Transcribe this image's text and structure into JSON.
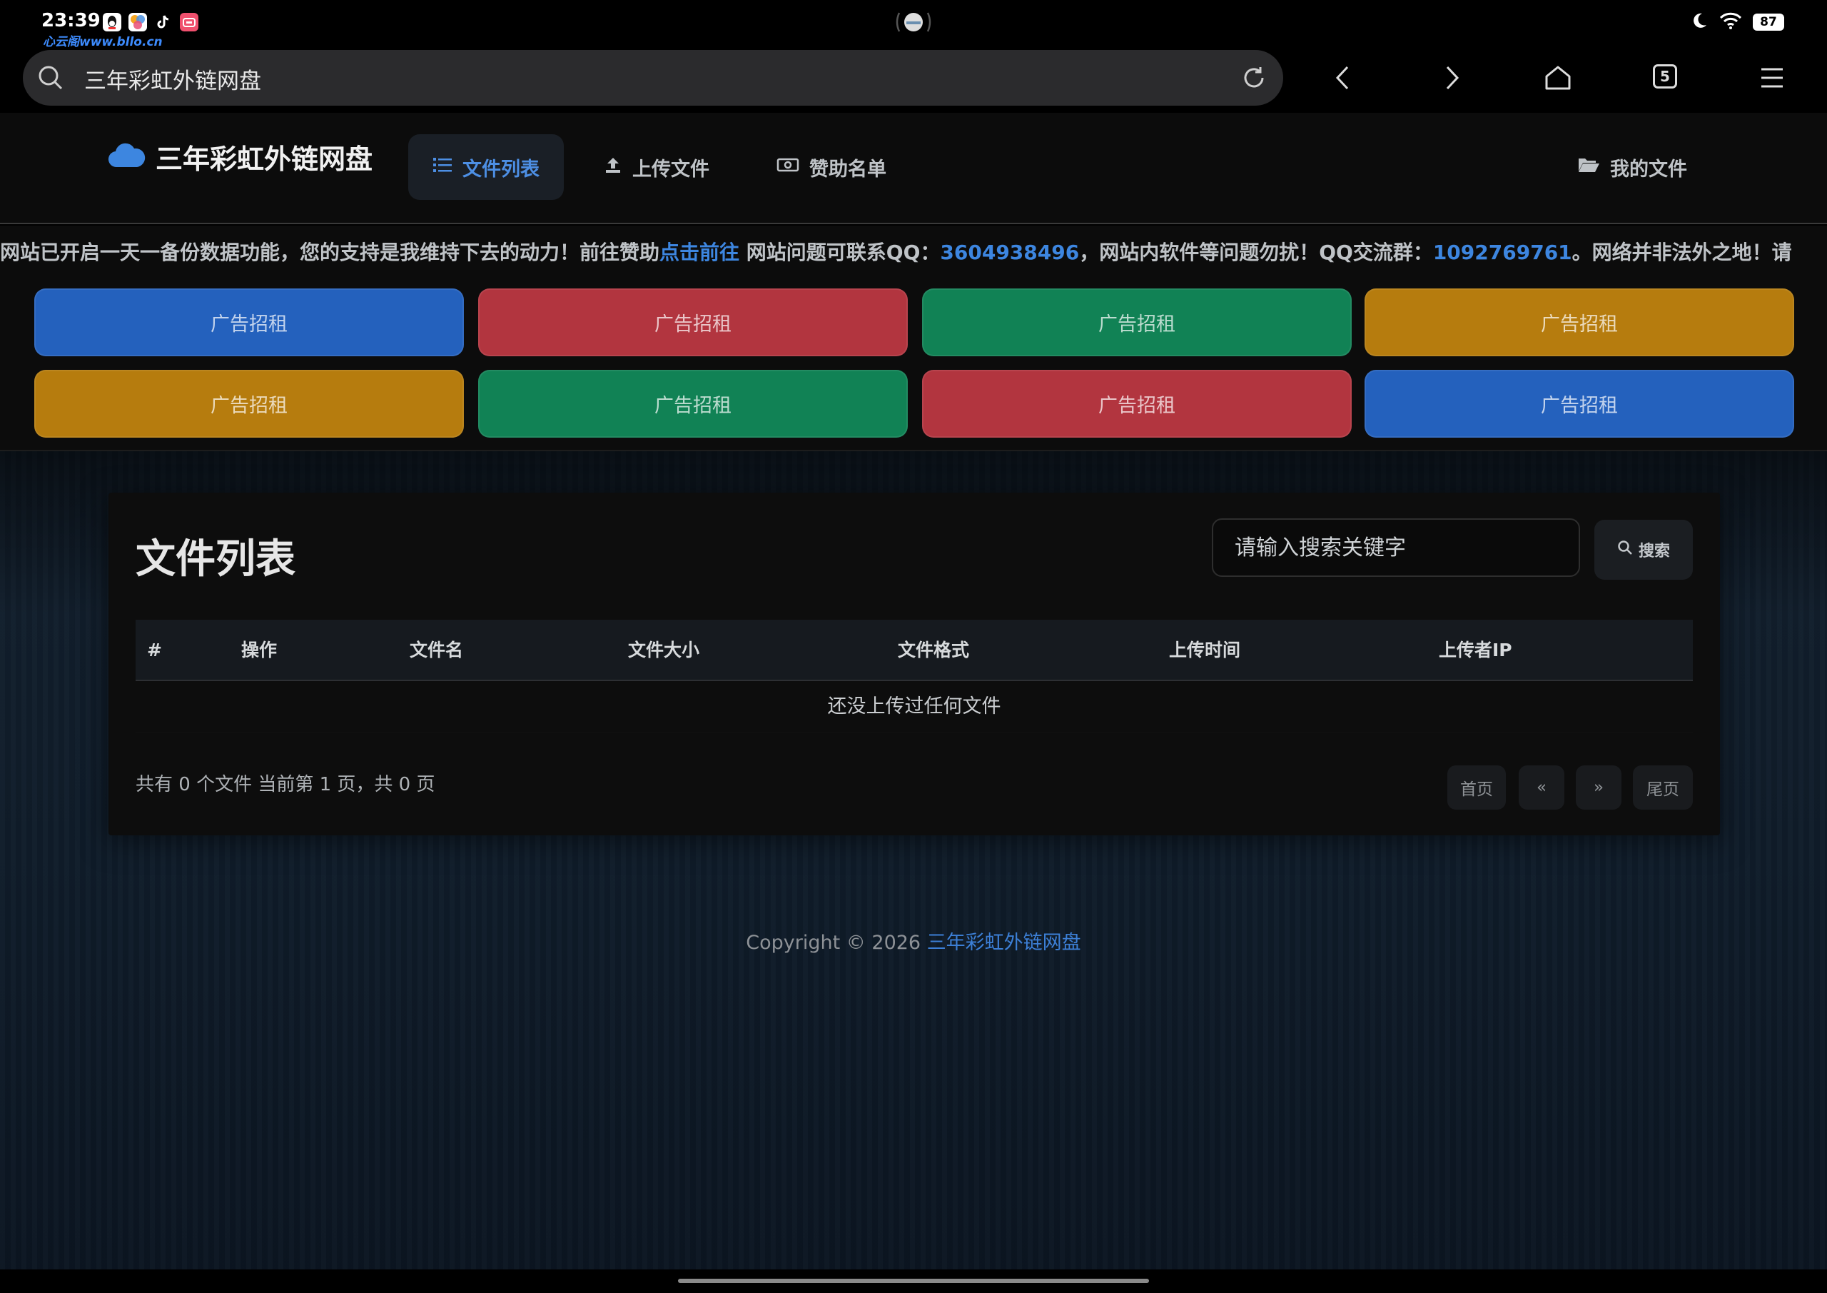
{
  "status_bar": {
    "time": "23:39",
    "watermark": "心云阁www.bllo.cn",
    "battery": "87"
  },
  "browser": {
    "address_text": "三年彩虹外链网盘",
    "tab_count": "5"
  },
  "site": {
    "brand": "三年彩虹外链网盘",
    "nav": {
      "file_list": "文件列表",
      "upload": "上传文件",
      "sponsors": "赞助名单",
      "my_files": "我的文件"
    }
  },
  "notice": {
    "part1": "网站已开启一天一备份数据功能，您的支持是我维持下去的动力！前往赞助",
    "link1": "点击前往",
    "part2": " 网站问题可联系QQ：",
    "qq": "3604938496",
    "part3": "，网站内软件等问题勿扰！QQ交流群：",
    "group": "1092769761",
    "part4": "。网络并非法外之地！请"
  },
  "ads": [
    {
      "label": "广告招租",
      "color": "#2461bd"
    },
    {
      "label": "广告招租",
      "color": "#b2353f"
    },
    {
      "label": "广告招租",
      "color": "#118255"
    },
    {
      "label": "广告招租",
      "color": "#b67c0e"
    },
    {
      "label": "广告招租",
      "color": "#b67c0e"
    },
    {
      "label": "广告招租",
      "color": "#118255"
    },
    {
      "label": "广告招租",
      "color": "#b2353f"
    },
    {
      "label": "广告招租",
      "color": "#2461bd"
    }
  ],
  "file_panel": {
    "title": "文件列表",
    "search_placeholder": "请输入搜索关键字",
    "search_button": "搜索",
    "columns": [
      "#",
      "操作",
      "文件名",
      "文件大小",
      "文件格式",
      "上传时间",
      "上传者IP"
    ],
    "empty_message": "还没上传过任何文件",
    "summary": "共有 0 个文件  当前第 1 页，共 0 页",
    "pagination": {
      "first": "首页",
      "prev": "«",
      "next": "»",
      "last": "尾页"
    }
  },
  "footer": {
    "copyright": "Copyright © 2026 ",
    "site_link": "三年彩虹外链网盘"
  },
  "colors": {
    "accent": "#3d86e0",
    "nav_active_bg": "#1a1f26",
    "page_bg": "#101d2b"
  }
}
